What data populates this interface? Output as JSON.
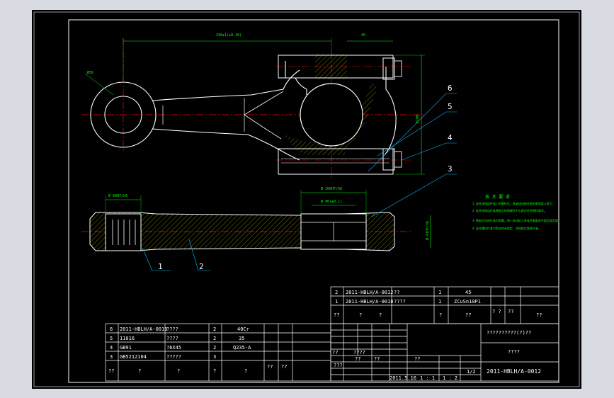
{
  "colors": {
    "background": "#000000",
    "part": "#ffffff",
    "centerline": "#ff0000",
    "dimension": "#00ff00",
    "leader": "#00bfff",
    "hatch": "#c8c800",
    "border": "#c0c0c0"
  },
  "dims": {
    "center_distance": "330±1(±0.10)",
    "width_45": "45",
    "small_end_dia": "Ø56",
    "big_end_height": "R100",
    "small_width": "Ø 60H7/h6",
    "big_bore_fit": "Ø 100H7/h6",
    "big_bore": "Ø 90(±0.1)",
    "side_dim": "Ø 41H7/h6"
  },
  "balloons": [
    "6",
    "5",
    "4",
    "3",
    "1",
    "2"
  ],
  "notes": {
    "title": "技 术 要 求",
    "lines": [
      "1.连杆体和连杆盖上的螺栓孔，其轴线对结合面的垂直度公差为",
      "2.连杆体和连杆盖装配后的两端孔中心距应符合图样要求。",
      "3.装配后应进行成对称重，同一发动机上各连杆重量差不超过规定值，",
      "4.连杆螺栓拧紧力矩应符合规定，并按规定顺序拧紧。"
    ]
  },
  "upper_bom": [
    {
      "no": "2",
      "code": "2011-HBLH/A-0012",
      "name": "??",
      "qty": "1",
      "mat": "45"
    },
    {
      "no": "1",
      "code": "2011-HBLH/A-0018",
      "name": "????",
      "qty": "1",
      "mat": "ZCuSn10P1"
    }
  ],
  "upper_header": {
    "no": "??",
    "code": "?",
    "name": "?",
    "qty": "?",
    "mat": "??",
    "w1": "? ?",
    "w2": "??",
    "note": "??"
  },
  "lower_bom": [
    {
      "no": "6",
      "code": "2011-HBLH/A-0019",
      "name": "????",
      "qty": "2",
      "mat": "40Cr"
    },
    {
      "no": "5",
      "code": "11016",
      "name": "????",
      "qty": "2",
      "mat": "35"
    },
    {
      "no": "4",
      "code": "GB91",
      "name": "?6X45",
      "qty": "2",
      "mat": "Q235-A"
    },
    {
      "no": "3",
      "code": "GB5212104",
      "name": "?????",
      "qty": "3",
      "mat": ""
    }
  ],
  "lower_header": {
    "no": "??",
    "code": "?",
    "name": "?",
    "qty": "?",
    "mat": "?",
    "w1": "??",
    "w2": "??"
  },
  "title_block": {
    "part_name": "??????????(?)??",
    "material": "????",
    "drawing_no": "2011-HBLH/A-0012",
    "small1": "??",
    "small2": "???",
    "small3": "??",
    "date": "2011.5.16",
    "scale1": "1 : 1",
    "scale2": "1 : 2",
    "sheet": "1/2",
    "design": "????",
    "check": "??",
    "hdr": "??"
  }
}
